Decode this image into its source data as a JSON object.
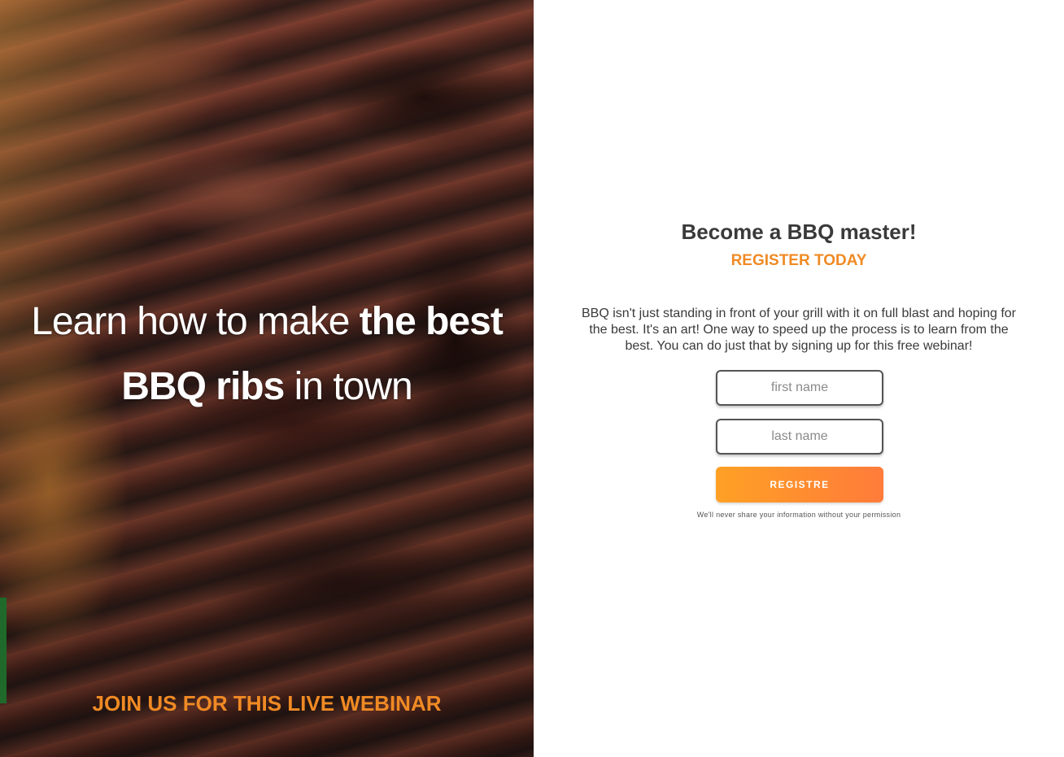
{
  "hero": {
    "title_pre": "Learn how to make ",
    "title_bold1": "the best",
    "title_bold2": "BBQ ribs",
    "title_post": " in town",
    "cta": "JOIN US FOR THIS LIVE WEBINAR",
    "image_name": "bbq-ribs-background"
  },
  "form": {
    "heading": "Become a BBQ master!",
    "subheading": "REGISTER TODAY",
    "description": "BBQ isn't just standing in front of your grill with it on full blast and hoping for the best. It's an art! One way to speed up the process is to learn from the best. You can do just that by signing up for this free webinar!",
    "first_name_placeholder": "first name",
    "first_name_value": "",
    "last_name_placeholder": "last name",
    "last_name_value": "",
    "submit_label": "REGISTRE",
    "privacy_note": "We'll never share your information without your permission"
  },
  "colors": {
    "accent": "#f08a24",
    "button_start": "#ffa125",
    "button_end": "#ff7b3a",
    "text_dark": "#3a3a3a"
  }
}
